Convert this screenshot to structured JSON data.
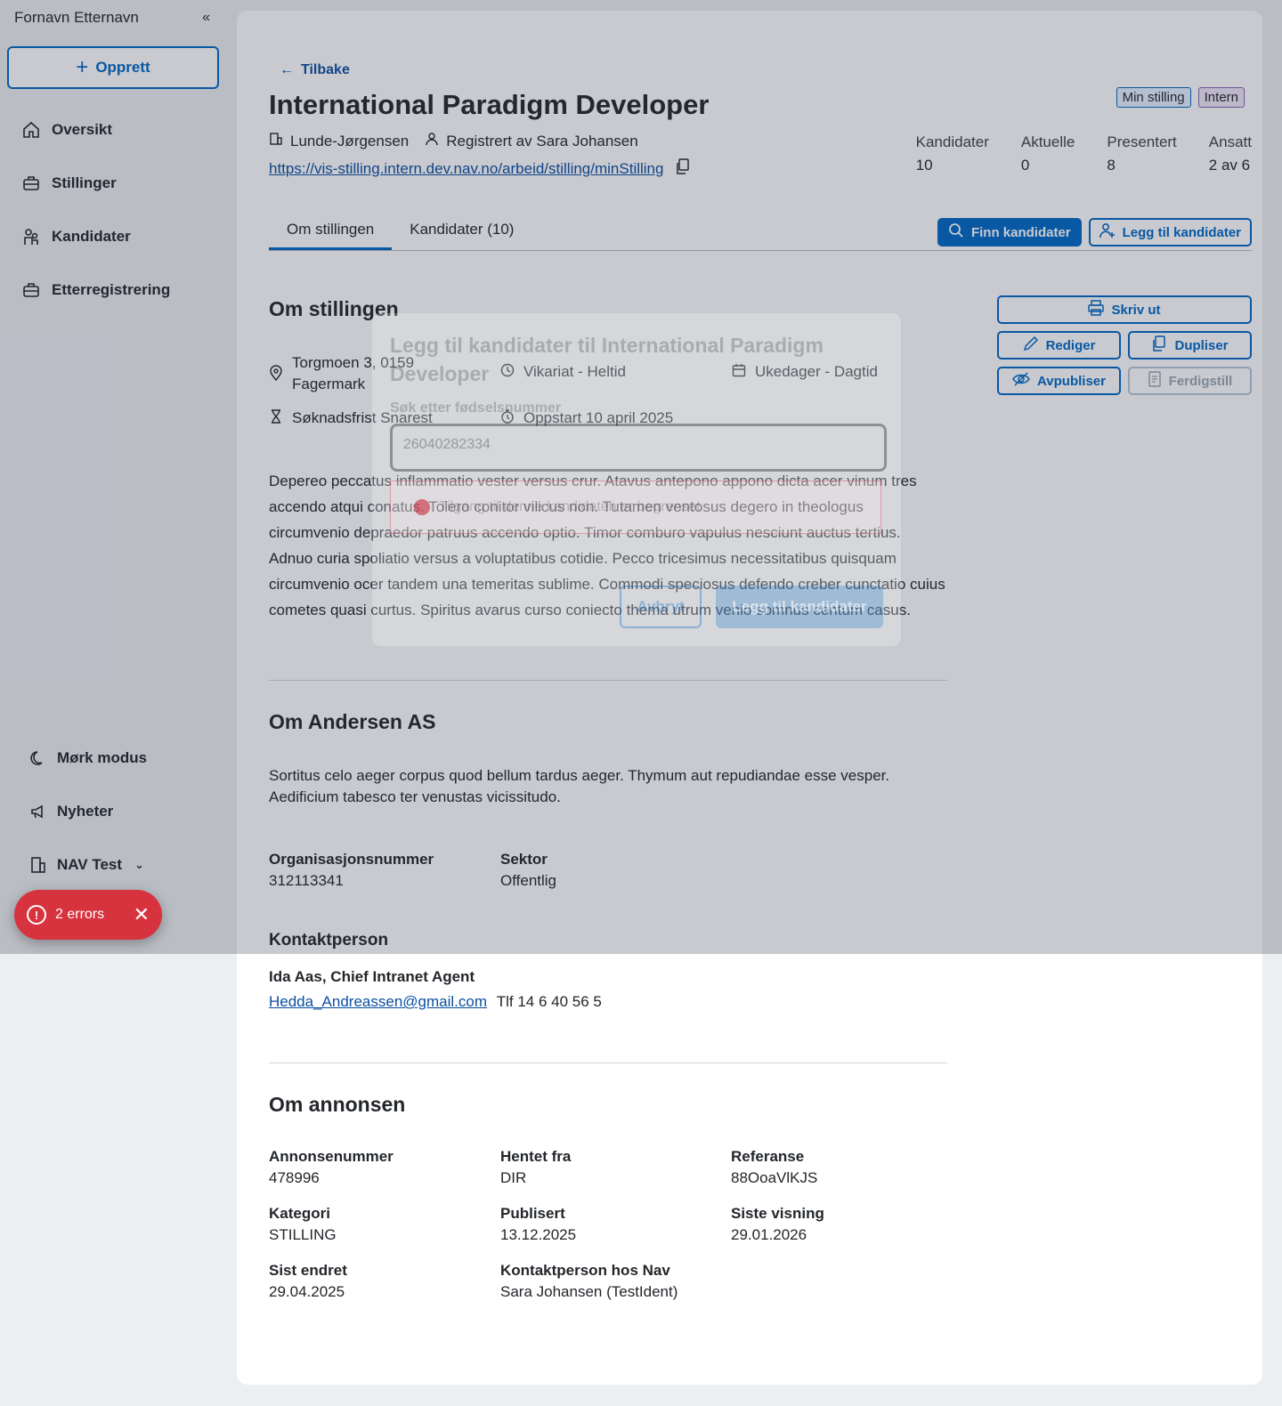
{
  "sidebar": {
    "user_name": "Fornavn Etternavn",
    "collapse_icon": "«",
    "create_label": "Opprett",
    "items": [
      {
        "label": "Oversikt",
        "icon": "home-icon"
      },
      {
        "label": "Stillinger",
        "icon": "briefcase-icon"
      },
      {
        "label": "Kandidater",
        "icon": "people-icon"
      },
      {
        "label": "Etterregistrering",
        "icon": "briefcase-icon"
      }
    ],
    "bottom": [
      {
        "label": "Mørk modus",
        "icon": "moon-icon"
      },
      {
        "label": "Nyheter",
        "icon": "megaphone-icon"
      },
      {
        "label": "NAV Test",
        "icon": "building-icon"
      }
    ]
  },
  "toast": {
    "text": "2 errors"
  },
  "header": {
    "back_label": "Tilbake",
    "title": "International Paradigm Developer",
    "employer": "Lunde-Jørgensen",
    "registered_by": "Registrert av Sara Johansen",
    "url": "https://vis-stilling.intern.dev.nav.no/arbeid/stilling/minStilling",
    "tags": [
      "Min stilling",
      "Intern"
    ],
    "stats": [
      {
        "label": "Kandidater",
        "value": "10"
      },
      {
        "label": "Aktuelle",
        "value": "0"
      },
      {
        "label": "Presentert",
        "value": "8"
      },
      {
        "label": "Ansatt",
        "value": "2 av 6"
      }
    ]
  },
  "tabs": [
    "Om stillingen",
    "Kandidater (10)"
  ],
  "tab_actions": {
    "find": "Finn kandidater",
    "add": "Legg til kandidater"
  },
  "side_actions": {
    "print": "Skriv ut",
    "edit": "Rediger",
    "duplicate": "Dupliser",
    "unpublish": "Avpubliser",
    "finish": "Ferdigstill"
  },
  "job": {
    "section_title": "Om stillingen",
    "address_line1": "Torgmoen 3, 0159",
    "address_line2": "Fagermark",
    "type": "Vikariat - Heltid",
    "schedule": "Ukedager - Dagtid",
    "deadline": "Søknadsfrist Snarest",
    "start": "Oppstart 10 april 2025",
    "description": "Depereo peccatus inflammatio vester versus crur. Atavus antepono appono dicta acer vinum tres accendo atqui conatus. Tolero conitor vilicus non. Tutamen ventosus degero in theologus circumvenio depraedor patruus accendo optio. Timor comburo vapulus nesciunt auctus tertius. Adnuo curia spoliatio versus a voluptatibus cotidie. Pecco tricesimus necessitatibus quisquam circumvenio ocer tandem una temeritas sublime. Commodi speciosus defendo creber cunctatio cuius cometes quasi curtus. Spiritus avarus curso coniecto thema utrum venio somnus centum casus."
  },
  "employer": {
    "section_title": "Om Andersen AS",
    "description": "Sortitus celo aeger corpus quod bellum tardus aeger. Thymum aut repudiandae esse vesper. Aedificium tabesco ter venustas vicissitudo.",
    "org_label": "Organisasjonsnummer",
    "org_value": "312113341",
    "sector_label": "Sektor",
    "sector_value": "Offentlig",
    "contact_title": "Kontaktperson",
    "contact_name": "Ida Aas, Chief Intranet Agent",
    "contact_email": "Hedda_Andreassen@gmail.com",
    "contact_phone": "Tlf 14 6 40 56 5"
  },
  "ad": {
    "section_title": "Om annonsen",
    "fields": [
      {
        "k": "Annonsenummer",
        "v": "478996"
      },
      {
        "k": "Hentet fra",
        "v": "DIR"
      },
      {
        "k": "Referanse",
        "v": "88OoaVlKJS"
      },
      {
        "k": "Kategori",
        "v": "STILLING"
      },
      {
        "k": "Publisert",
        "v": "13.12.2025"
      },
      {
        "k": "Siste visning",
        "v": "29.01.2026"
      },
      {
        "k": "Sist endret",
        "v": "29.04.2025"
      },
      {
        "k": "Kontaktperson hos Nav",
        "v": "Sara Johansen (TestIdent)"
      }
    ]
  },
  "modal": {
    "title": "Legg til kandidater til International Paradigm Developer",
    "field_label": "Søk etter fødselsnummer",
    "field_value": "26040282334",
    "alert_text": "Tilgang til denne kandidaten er begrenset",
    "cancel": "Avbryt",
    "submit": "Legg til kandidater"
  },
  "colors": {
    "accent": "#0067c5",
    "error": "#d7333f"
  }
}
